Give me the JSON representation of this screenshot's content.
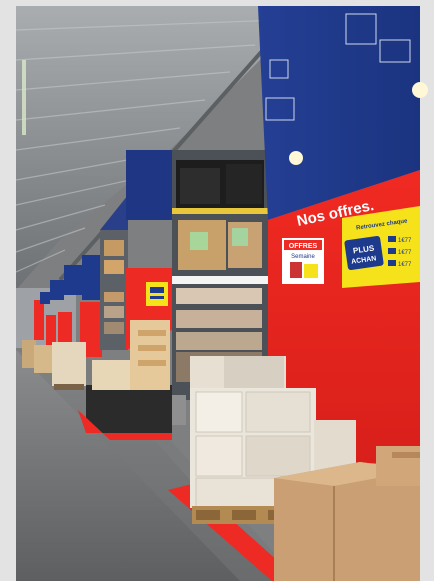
{
  "photo": {
    "subject": "warehouse-store-aisle",
    "end_cap_heading": "Nos offres.",
    "promo_card": {
      "header": "Retrouvez chaque",
      "badge_line1": "PLUS",
      "badge_line2": "ACHAN",
      "rows": [
        "1€77",
        "1€77",
        "1€77"
      ]
    },
    "left_sign": {
      "line1": "OFFRES",
      "line2": "Semaine"
    },
    "colors": {
      "brand_red": "#ee2a24",
      "brand_blue": "#1e3a8c",
      "promo_yellow": "#f5e21a",
      "floor": "#6f6f70",
      "ceiling": "#8f9395"
    }
  }
}
